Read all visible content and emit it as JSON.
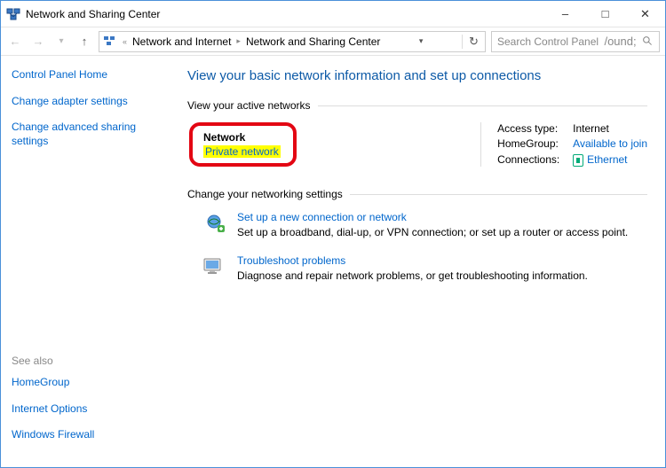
{
  "titlebar": {
    "title": "Network and Sharing Center"
  },
  "breadcrumb": {
    "item1": "Network and Internet",
    "item2": "Network and Sharing Center"
  },
  "search": {
    "placeholder": "Search Control Panel"
  },
  "sidebar": {
    "home": "Control Panel Home",
    "adapter": "Change adapter settings",
    "advanced": "Change advanced sharing settings",
    "seealso": "See also",
    "homegroup": "HomeGroup",
    "internet_options": "Internet Options",
    "firewall": "Windows Firewall"
  },
  "main": {
    "title": "View your basic network information and set up connections",
    "active_hdr": "View your active networks",
    "network": {
      "name": "Network",
      "type": "Private network"
    },
    "details": {
      "access_label": "Access type:",
      "access_value": "Internet",
      "homegroup_label": "HomeGroup:",
      "homegroup_value": "Available to join",
      "connections_label": "Connections:",
      "connections_value": "Ethernet"
    },
    "change_hdr": "Change your networking settings",
    "setup": {
      "title": "Set up a new connection or network",
      "desc": "Set up a broadband, dial-up, or VPN connection; or set up a router or access point."
    },
    "troubleshoot": {
      "title": "Troubleshoot problems",
      "desc": "Diagnose and repair network problems, or get troubleshooting information."
    }
  }
}
